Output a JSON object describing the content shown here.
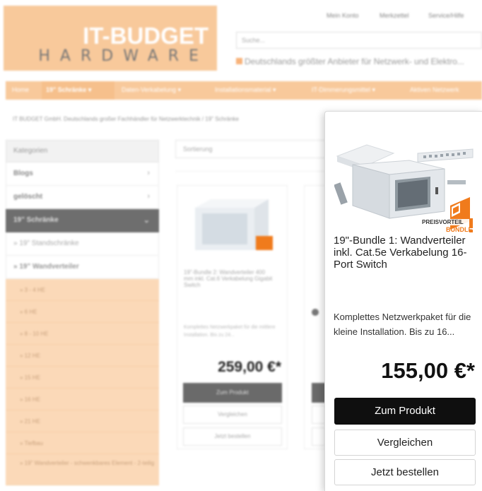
{
  "logo": {
    "line1": "IT-BUDGET",
    "line2": "HARDWARE"
  },
  "top_links": [
    "Mein Konto",
    "Merkzettel",
    "Service/Hilfe"
  ],
  "search": {
    "placeholder": "Suche..."
  },
  "tagline": "Deutschlands größter Anbieter für Netzwerk- und Elektro...",
  "nav": {
    "items": [
      "Home",
      "19\" Schränke",
      "Daten-Verkabelung",
      "Installationsmaterial",
      "IT-Dimmerungsmittel",
      "Aktiven Netzwerk"
    ],
    "active_index": 1
  },
  "breadcrumb": "IT BUDGET GmbH. Deutschlands großer Fachhändler für Netzwerktechnik / 19\" Schränke",
  "sidebar": {
    "heading": "Kategorien",
    "items": [
      {
        "label": "Blogs",
        "style": "plain"
      },
      {
        "label": "gelöscht",
        "style": "plain"
      },
      {
        "label": "19\" Schränke",
        "style": "dark"
      },
      {
        "label": "» 19\" Standschränke",
        "style": "sub"
      },
      {
        "label": "» 19\" Wandverteiler",
        "style": "sub2"
      }
    ],
    "subitems": [
      "» 3 - 4 HE",
      "» 6 HE",
      "» 8 - 10 HE",
      "» 12 HE",
      "» 15 HE",
      "» 16 HE",
      "» 21 HE",
      "» Tiefbau",
      "» 19\" Wandverteiler - schwenkbares Element - 2-teilig"
    ]
  },
  "sort": {
    "label": "Sortierung"
  },
  "products": [
    {
      "title": "19\"-Bundle 2: Wandverteiler 400 mm inkl. Cat.6 Verkabelung Gigabit Switch",
      "desc": "Komplettes Netzwerkpaket für die mittlere Installation. Bis zu 24...",
      "price": "259,00 €*",
      "btn": "Zum Produkt",
      "compare": "Vergleichen",
      "buy": "Jetzt bestellen"
    }
  ],
  "popup": {
    "badge_line1": "PREISVORTEIL",
    "badge_line2": "BUNDLE",
    "title": "19\"-Bundle 1: Wandverteiler inkl. Cat.5e Verkabelung 16-Port Switch",
    "desc": "Komplettes Netzwerkpaket für die kleine Installation. Bis zu 16...",
    "price": "155,00 €*",
    "btn": "Zum Produkt",
    "compare": "Vergleichen",
    "buy": "Jetzt bestellen"
  },
  "colors": {
    "brand": "#f8c99b",
    "dark_button": "#0f0f0f",
    "badge": "#f07b1c"
  }
}
